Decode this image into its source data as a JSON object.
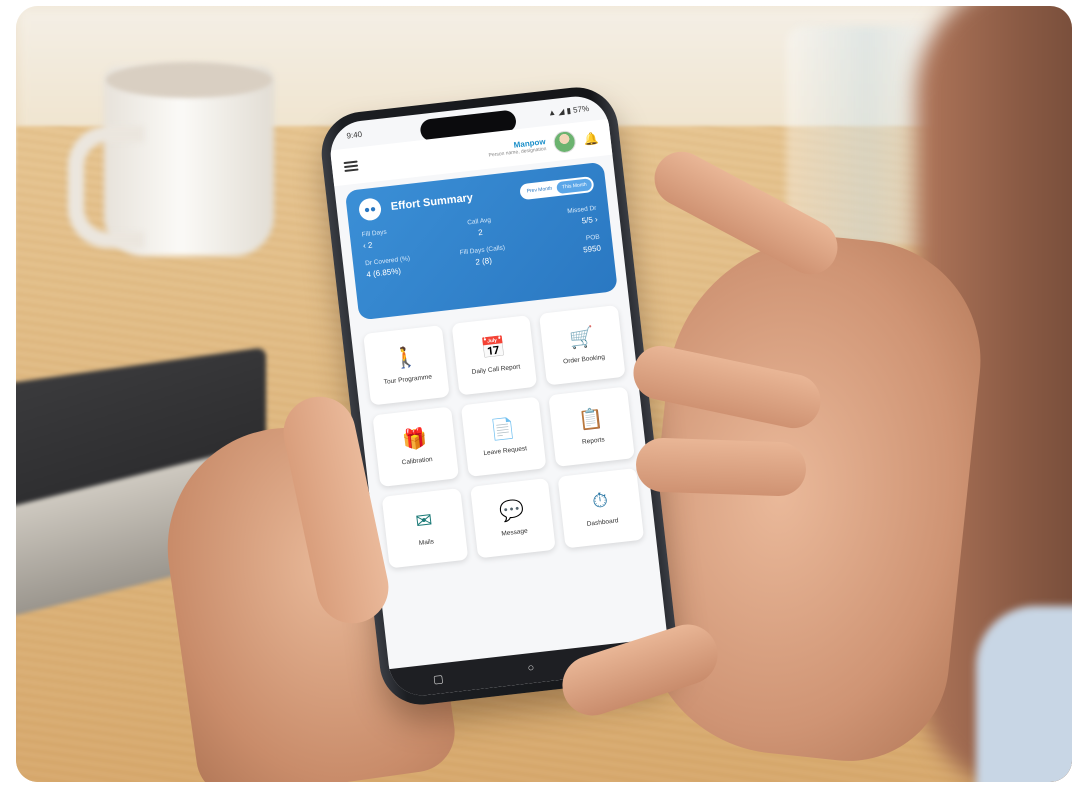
{
  "status_bar": {
    "time": "9:40",
    "indicators": "▲ ◢ ▮ 57%"
  },
  "app_header": {
    "menu_icon": "hamburger-icon",
    "title": "Manpow",
    "subtitle": "Person name, designation",
    "avatar_icon": "avatar",
    "bell_icon": "bell-icon"
  },
  "summary": {
    "title": "Effort Summary",
    "toggle": [
      "Prev Month",
      "This Month"
    ],
    "stats": [
      {
        "label": "Fill Days",
        "value": "2"
      },
      {
        "label": "Call Avg",
        "value": "2"
      },
      {
        "label": "Missed Dr",
        "value": "5/5"
      },
      {
        "label": "Dr Covered (%)",
        "value": "4 (6.85%)"
      },
      {
        "label": "Fill Days (Calls)",
        "value": "2 (8)"
      },
      {
        "label": "POB",
        "value": "5950"
      }
    ]
  },
  "tiles": [
    {
      "label": "Tour Programme",
      "icon": "walking-person-icon",
      "glyph": "🚶",
      "color": "#1b4f72"
    },
    {
      "label": "Daily Call Report",
      "icon": "calendar-check-icon",
      "glyph": "📅",
      "color": "#e2474b"
    },
    {
      "label": "Order Booking",
      "icon": "cart-icon",
      "glyph": "🛒",
      "color": "#18826b"
    },
    {
      "label": "Calibration",
      "icon": "gift-icon",
      "glyph": "🎁",
      "color": "#8e6bbf"
    },
    {
      "label": "Leave Request",
      "icon": "document-icon",
      "glyph": "📄",
      "color": "#2d6cc9"
    },
    {
      "label": "Reports",
      "icon": "report-icon",
      "glyph": "📋",
      "color": "#e04a52"
    },
    {
      "label": "Mails",
      "icon": "mail-icon",
      "glyph": "✉",
      "color": "#1b7a77"
    },
    {
      "label": "Message",
      "icon": "chat-bubbles-icon",
      "glyph": "💬",
      "color": "#7d74d6"
    },
    {
      "label": "Dashboard",
      "icon": "gauge-icon",
      "glyph": "⏱",
      "color": "#1d6f9f"
    }
  ],
  "nav_bar": {
    "recents": "▢",
    "home": "○",
    "back": "◁"
  }
}
